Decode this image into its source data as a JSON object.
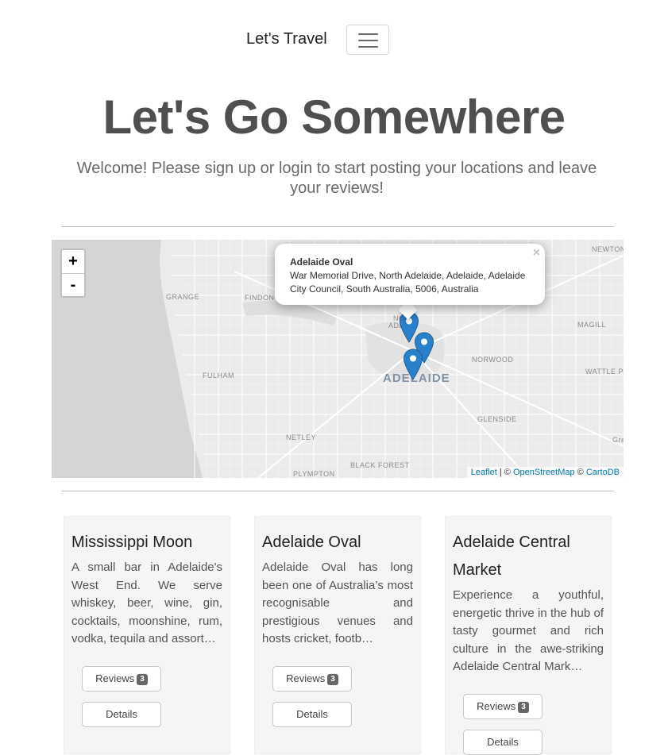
{
  "nav": {
    "brand": "Let's Travel",
    "toggle_icon": "hamburger-icon"
  },
  "hero": {
    "title": "Let's Go Somewhere",
    "subtitle": "Welcome! Please sign up or login to start posting your locations and leave your reviews!"
  },
  "map": {
    "zoom_in": "+",
    "zoom_out": "-",
    "center_label": "ADELAIDE",
    "place_labels": [
      "NEWTON",
      "GRANGE",
      "FINDON",
      "MAGILL",
      "NORWOOD",
      "WATTLE PARK",
      "FULHAM",
      "GLENSIDE",
      "NETLEY",
      "BLACK FOREST",
      "PLYMPTON",
      "Gre",
      "NO",
      "ADE"
    ],
    "popup": {
      "title": "Adelaide Oval",
      "address": "War Memorial Drive, North Adelaide, Adelaide, Adelaide City Council, South Australia, 5006, Australia",
      "close": "×"
    },
    "attribution": {
      "leaflet": "Leaflet",
      "sep1": " | © ",
      "osm": "OpenStreetMap",
      "sep2": " © ",
      "carto": "CartoDB"
    },
    "marker_color": "#2a81cb"
  },
  "cards": [
    {
      "title": "Mississippi Moon",
      "text": "A small bar in Adelaide's West End. We serve whiskey, beer, wine, gin, cocktails, moonshine, rum, vodka, tequila and assort…",
      "reviews_label": "Reviews",
      "reviews_count": "3",
      "details_label": "Details"
    },
    {
      "title": "Adelaide Oval",
      "text": "Adelaide Oval has long been one of Australia’s most recognisable and prestigious venues and hosts cricket, footb…",
      "reviews_label": "Reviews",
      "reviews_count": "3",
      "details_label": "Details"
    },
    {
      "title": "Adelaide Central Market",
      "text": "Experience a youthful, energetic thrive in the hub of tasty gourmet and rich culture in the awe-striking Adelaide Central Mark…",
      "reviews_label": "Reviews",
      "reviews_count": "3",
      "details_label": "Details"
    }
  ]
}
